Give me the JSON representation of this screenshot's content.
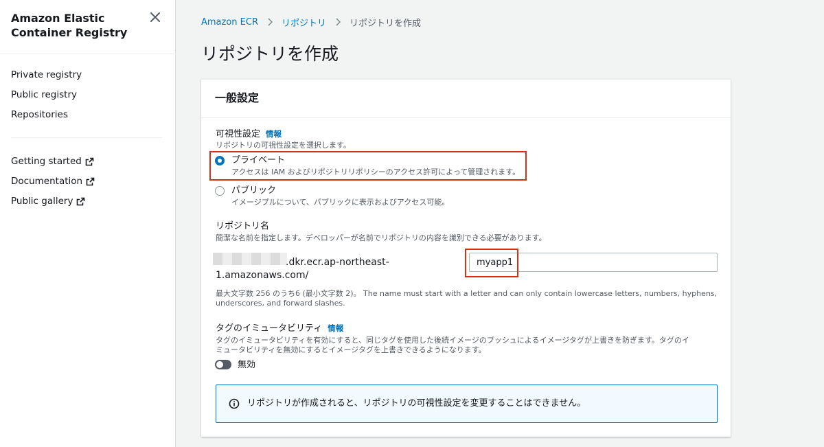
{
  "sidebar": {
    "title": "Amazon Elastic Container Registry",
    "nav": [
      {
        "label": "Private registry"
      },
      {
        "label": "Public registry"
      },
      {
        "label": "Repositories"
      }
    ],
    "links": [
      {
        "label": "Getting started",
        "icon": "external-link-icon"
      },
      {
        "label": "Documentation",
        "icon": "external-link-icon"
      },
      {
        "label": "Public gallery",
        "icon": "external-link-icon"
      }
    ]
  },
  "breadcrumb": {
    "items": [
      "Amazon ECR",
      "リポジトリ",
      "リポジトリを作成"
    ]
  },
  "page_title": "リポジトリを作成",
  "card": {
    "title": "一般設定",
    "visibility": {
      "label": "可視性設定",
      "info": "情報",
      "description": "リポジトリの可視性設定を選択します。",
      "options": [
        {
          "title": "プライベート",
          "description": "アクセスは IAM およびリポジトリリポリシーのアクセス許可によって管理されます。",
          "selected": true
        },
        {
          "title": "パブリック",
          "description": "イメージプルについて、パブリックに表示およびアクセス可能。",
          "selected": false
        }
      ]
    },
    "repo_name": {
      "label": "リポジトリ名",
      "description": "簡潔な名前を指定します。デベロッパーが名前でリポジトリの内容を識別できる必要があります。",
      "uri_line1": ".dkr.ecr.ap-northeast-",
      "uri_line2": "1.amazonaws.com/",
      "value": "myapp1",
      "constraint_line1": "最大文字数 256 のうち6 (最小文字数 2)。 The name must start with a letter and can only contain lowercase letters, numbers, hyphens,",
      "constraint_line2": "underscores, and forward slashes."
    },
    "immutability": {
      "label": "タグのイミュータビリティ",
      "info": "情報",
      "description_line1": "タグのイミュータビリティを有効にすると、同じタグを使用した後続イメージのプッシュによるイメージタグが上書きを防ぎます。タグのイ",
      "description_line2": "ミュータビリティを無効にするとイメージタグを上書きできるようになります。",
      "toggle_label": "無効",
      "enabled": false
    },
    "alert": {
      "text": "リポジトリが作成されると、リポジトリの可視性設定を変更することはできません。",
      "icon": "info-icon"
    }
  },
  "colors": {
    "link": "#0073bb",
    "highlight": "#d13212",
    "alert_bg": "#f1faff"
  }
}
